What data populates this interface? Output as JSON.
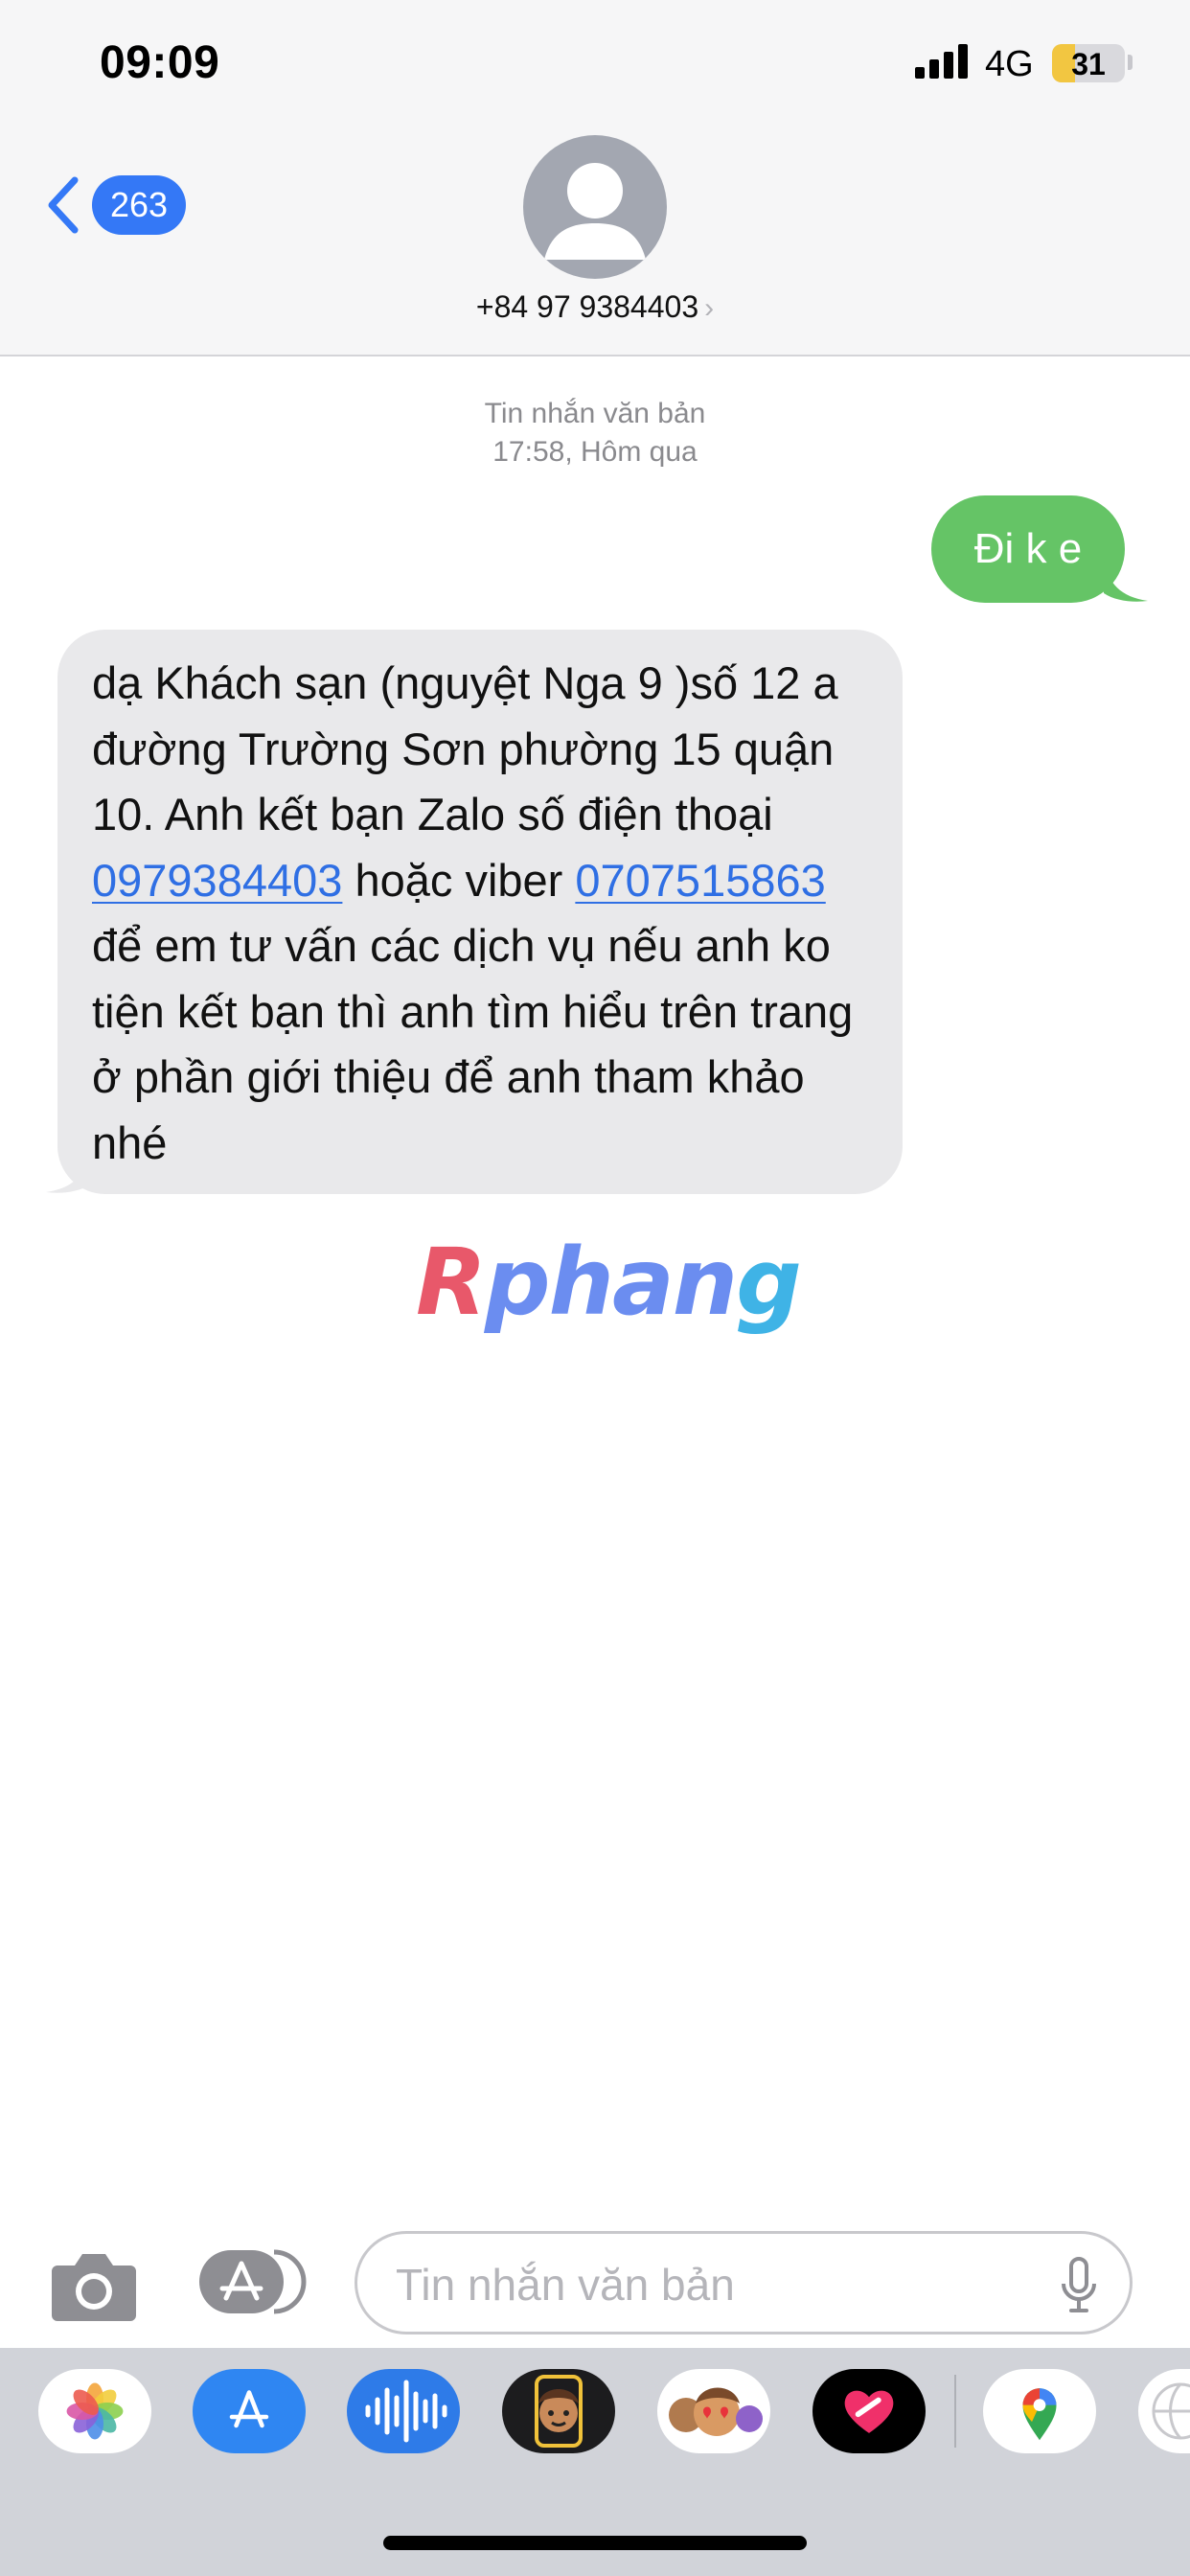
{
  "status_bar": {
    "time": "09:09",
    "network": "4G",
    "battery": "31",
    "battery_level": 0.31,
    "battery_color": "#f2c641"
  },
  "header": {
    "back_icon": "chevron-left-icon",
    "unread_badge": "263",
    "avatar_icon": "person-silhouette-icon",
    "contact": "+84 97 9384403",
    "contact_chevron": "›"
  },
  "conversation": {
    "label": "Tin nhắn văn bản",
    "timestamp": "17:58, Hôm qua",
    "outgoing_message": "Đi k e",
    "incoming_message": {
      "part1": "dạ Khách sạn (nguyệt Nga 9 )số 12 a đường Trường Sơn phường 15 quận 10. Anh kết bạn Zalo số điện thoại ",
      "link1": "0979384403",
      "part2": " hoặc  viber ",
      "link2": "0707515863",
      "part3": "  để em tư vấn các dịch vụ nếu anh ko tiện kết bạn thì anh tìm hiểu trên trang ở phần giới thiệu để anh tham khảo nhé"
    },
    "watermark": {
      "part1": "R",
      "part2": "phan",
      "part3": "g"
    },
    "colors": {
      "outgoing_bubble": "#65c466",
      "incoming_bubble": "#e9e9eb",
      "link": "#2f6fe4",
      "accent": "#3478f6"
    }
  },
  "compose": {
    "placeholder": "Tin nhắn văn bản",
    "camera_icon": "camera-icon",
    "apps_icon": "app-store-icon",
    "mic_icon": "microphone-icon"
  },
  "app_drawer": {
    "apps": [
      "photos-icon",
      "app-store-icon",
      "audio-message-icon",
      "memoji-icon",
      "memoji-stickers-icon",
      "digital-touch-icon",
      "google-maps-icon",
      "globe-icon"
    ]
  }
}
